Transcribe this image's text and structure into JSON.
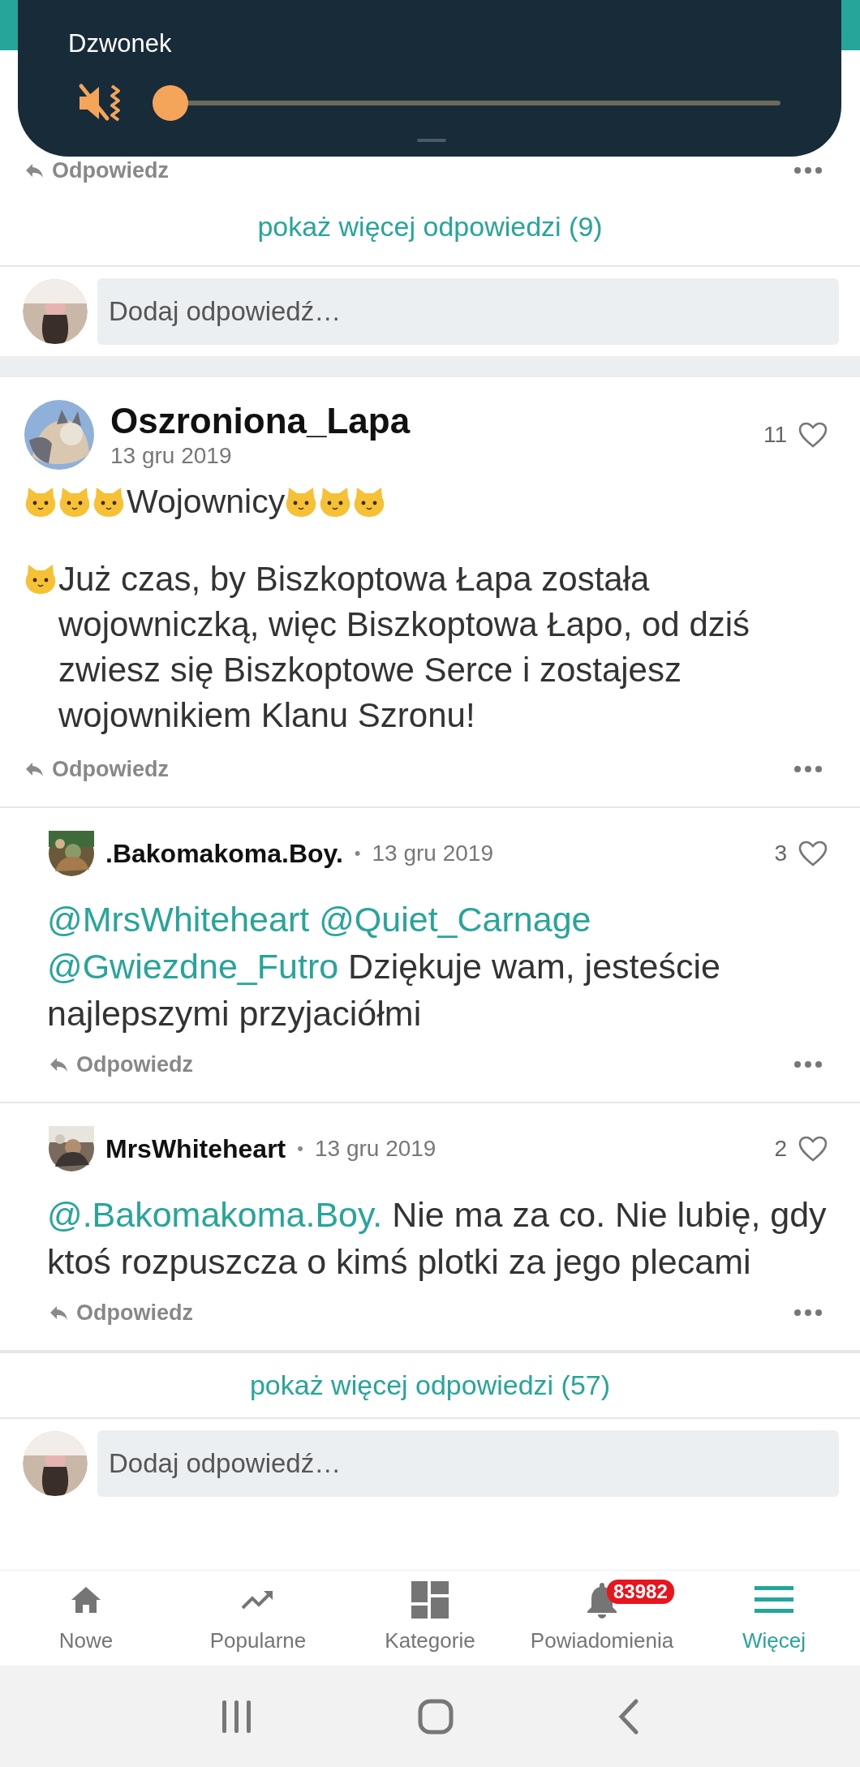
{
  "volume_panel": {
    "title": "Dzwonek",
    "level": 0
  },
  "previous_thread": {
    "reply_label": "Odpowiedz",
    "more_replies": "pokaż więcej odpowiedzi (9)",
    "reply_placeholder": "Dodaj odpowiedź…"
  },
  "post": {
    "author": "Oszroniona_Lapa",
    "date": "13 gru 2019",
    "likes": "11",
    "reply_label": "Odpowiedz",
    "body": [
      {
        "kind": "heading",
        "text": "Wojownicy"
      },
      {
        "kind": "paragraph",
        "text": "Już czas, by Biszkoptowa Łapa została wojowniczką, więc Biszkoptowa Łapo, od dziś zwiesz się Biszkoptowe Serce i zostajesz wojownikiem Klanu Szronu!"
      }
    ]
  },
  "replies": [
    {
      "author": ".Bakomakoma.Boy.",
      "separator": "•",
      "date": "13 gru 2019",
      "likes": "3",
      "mentions": [
        "@MrsWhiteheart",
        "@Quiet_Carnage",
        "@Gwiezdne_Futro"
      ],
      "text": "Dziękuje wam, jesteście najlepszymi przyjaciółmi",
      "reply_label": "Odpowiedz"
    },
    {
      "author": "MrsWhiteheart",
      "separator": "•",
      "date": "13 gru 2019",
      "likes": "2",
      "mentions": [
        "@.Bakomakoma.Boy."
      ],
      "text": "Nie ma za co. Nie lubię, gdy ktoś rozpuszcza o kimś plotki za jego plecami",
      "reply_label": "Odpowiedz"
    }
  ],
  "more_replies": "pokaż więcej odpowiedzi (57)",
  "reply_placeholder": "Dodaj odpowiedź…",
  "bottom_nav": [
    {
      "kind": "home",
      "label": "Nowe",
      "selected": false
    },
    {
      "kind": "trending",
      "label": "Popularne",
      "selected": false
    },
    {
      "kind": "categories",
      "label": "Kategorie",
      "selected": false
    },
    {
      "kind": "bell",
      "label": "Powiadomienia",
      "badge": "83982",
      "selected": false
    },
    {
      "kind": "menu",
      "label": "Więcej",
      "selected": true
    }
  ]
}
